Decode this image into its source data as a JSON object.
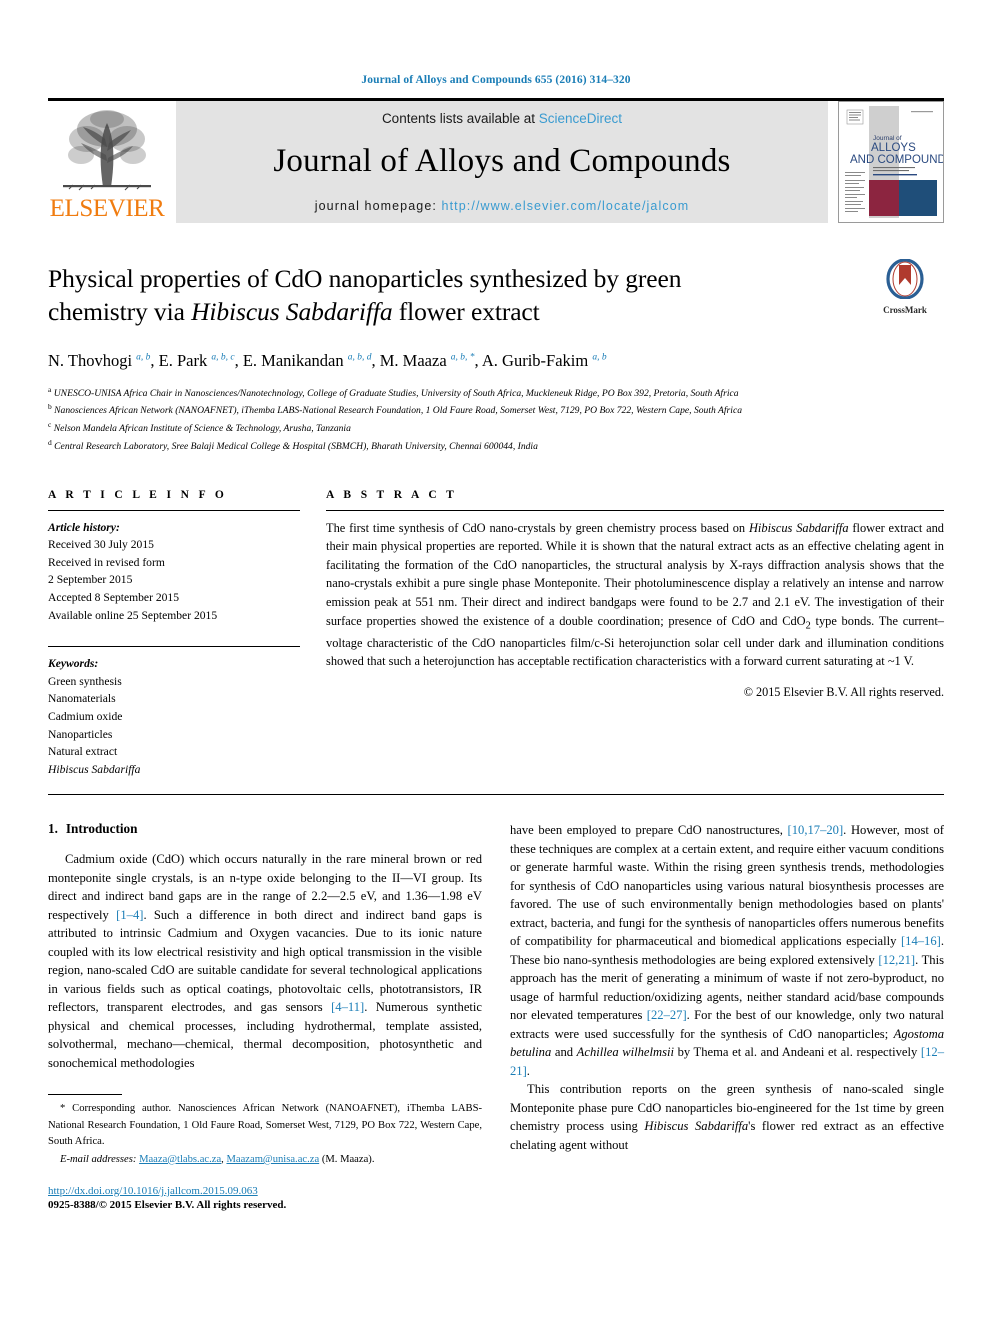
{
  "running_head": "Journal of Alloys and Compounds 655 (2016) 314–320",
  "masthead": {
    "publisher_logo_text": "ELSEVIER",
    "contents_prefix": "Contents lists available at ",
    "contents_link": "ScienceDirect",
    "journal_title": "Journal of Alloys and Compounds",
    "homepage_prefix": "journal homepage: ",
    "homepage_url": "http://www.elsevier.com/locate/jalcom",
    "cover": {
      "line1": "Journal of",
      "line2": "ALLOYS",
      "line3": "AND COMPOUNDS"
    }
  },
  "article": {
    "title_part1": "Physical properties of CdO nanoparticles synthesized by green chemistry via ",
    "title_italic": "Hibiscus Sabdariffa",
    "title_part2": " flower extract",
    "crossmark_label": "CrossMark",
    "authors": [
      {
        "name": "N. Thovhogi",
        "sup": "a, b",
        "sep": ", "
      },
      {
        "name": "E. Park",
        "sup": "a, b, c",
        "sep": ", "
      },
      {
        "name": "E. Manikandan",
        "sup": "a, b, d",
        "sep": ", "
      },
      {
        "name": "M. Maaza",
        "sup": "a, b, *",
        "sep": ", "
      },
      {
        "name": "A. Gurib-Fakim",
        "sup": "a, b",
        "sep": ""
      }
    ],
    "affiliations": [
      {
        "mark": "a",
        "text": "UNESCO-UNISA Africa Chair in Nanosciences/Nanotechnology, College of Graduate Studies, University of South Africa, Muckleneuk Ridge, PO Box 392, Pretoria, South Africa"
      },
      {
        "mark": "b",
        "text": "Nanosciences African Network (NANOAFNET), iThemba LABS-National Research Foundation, 1 Old Faure Road, Somerset West, 7129, PO Box 722, Western Cape, South Africa"
      },
      {
        "mark": "c",
        "text": "Nelson Mandela African Institute of Science & Technology, Arusha, Tanzania"
      },
      {
        "mark": "d",
        "text": "Central Research Laboratory, Sree Balaji Medical College & Hospital (SBMCH), Bharath University, Chennai 600044, India"
      }
    ]
  },
  "article_info": {
    "heading": "A R T I C L E   I N F O",
    "history_label": "Article history:",
    "history": [
      "Received 30 July 2015",
      "Received in revised form",
      "2 September 2015",
      "Accepted 8 September 2015",
      "Available online 25 September 2015"
    ],
    "keywords_label": "Keywords:",
    "keywords": [
      "Green synthesis",
      "Nanomaterials",
      "Cadmium oxide",
      "Nanoparticles",
      "Natural extract",
      "Hibiscus Sabdariffa"
    ],
    "keywords_italic_index": 5
  },
  "abstract": {
    "heading": "A B S T R A C T",
    "p1": "The first time synthesis of CdO nano-crystals by green chemistry process based on ",
    "p1_italic": "Hibiscus Sabdariffa",
    "p2": " flower extract and their main physical properties are reported. While it is shown that the natural extract acts as an effective chelating agent in facilitating the formation of the CdO nanoparticles, the structural analysis by X-rays diffraction analysis shows that the nano-crystals exhibit a pure single phase Monteponite. Their photoluminescence display a relatively an intense and narrow emission peak at 551 nm. Their direct and indirect bandgaps were found to be 2.7 and 2.1 eV. The investigation of their surface properties showed the existence of a double coordination; presence of CdO and CdO",
    "p2_sub": "2",
    "p3": " type bonds. The current–voltage characteristic of the CdO nanoparticles film/c-Si heterojunction solar cell under dark and illumination conditions showed that such a heterojunction has acceptable rectification characteristics with a forward current saturating at ~1 V.",
    "copyright": "© 2015 Elsevier B.V. All rights reserved."
  },
  "intro": {
    "heading_num": "1.",
    "heading_text": "Introduction",
    "left_p1_a": "Cadmium oxide (CdO) which occurs naturally in the rare mineral brown or red monteponite single crystals, is an n-type oxide belonging to the II—VI group. Its direct and indirect band gaps are in the range of 2.2—2.5 eV, and 1.36—1.98 eV respectively ",
    "left_ref1": "[1–4]",
    "left_p1_b": ". Such a difference in both direct and indirect band gaps is attributed to intrinsic Cadmium and Oxygen vacancies. Due to its ionic nature coupled with its low electrical resistivity and high optical transmission in the visible region, nano-scaled CdO are suitable candidate for several technological applications in various fields such as optical coatings, photovoltaic cells, phototransistors, IR reflectors, transparent electrodes, and gas sensors ",
    "left_ref2": "[4–11]",
    "left_p1_c": ". Numerous synthetic physical and chemical processes, including hydrothermal, template assisted, solvothermal, mechano—chemical, thermal decomposition, photosynthetic and sonochemical methodologies",
    "right_p1_a": "have been employed to prepare CdO nanostructures, ",
    "right_ref1": "[10,17–20]",
    "right_p1_b": ". However, most of these techniques are complex at a certain extent, and require either vacuum conditions or generate harmful waste. Within the rising green synthesis trends, methodologies for synthesis of CdO nanoparticles using various natural biosynthesis processes are favored. The use of such environmentally benign methodologies based on plants' extract, bacteria, and fungi for the synthesis of nanoparticles offers numerous benefits of compatibility for pharmaceutical and biomedical applications especially ",
    "right_ref2": "[14–16]",
    "right_p1_c": ". These bio nano-synthesis methodologies are being explored extensively ",
    "right_ref3": "[12,21]",
    "right_p1_d": ". This approach has the merit of generating a minimum of waste if not zero-byproduct, no usage of harmful reduction/oxidizing agents, neither standard acid/base compounds nor elevated temperatures ",
    "right_ref4": "[22–27]",
    "right_p1_e": ". For the best of our knowledge, only two natural extracts were used successfully for the synthesis of CdO nanoparticles; ",
    "right_it1": "Agostoma betulina",
    "right_p1_f": " and ",
    "right_it2": "Achillea wilhelmsii",
    "right_p1_g": " by Thema et al. and Andeani et al. respectively ",
    "right_ref5": "[12–21]",
    "right_p1_h": ".",
    "right_p2_a": "This contribution reports on the green synthesis of nano-scaled single Monteponite phase pure CdO nanoparticles bio-engineered for the 1st time by green chemistry process using ",
    "right_it3": "Hibiscus Sabdariffa",
    "right_p2_b": "'s flower red extract as an effective chelating agent without"
  },
  "footnote": {
    "star": "*",
    "text": " Corresponding author. Nanosciences African Network (NANOAFNET), iThemba LABS-National Research Foundation, 1 Old Faure Road, Somerset West, 7129, PO Box 722, Western Cape, South Africa.",
    "email_label": "E-mail addresses:",
    "email1": "Maaza@tlabs.ac.za",
    "email_sep": ", ",
    "email2": "Maazam@unisa.ac.za",
    "email_suffix": " (M. Maaza).",
    "doi": "http://dx.doi.org/10.1016/j.jallcom.2015.09.063",
    "issn": "0925-8388/© 2015 Elsevier B.V. All rights reserved."
  },
  "colors": {
    "link_blue": "#1a7db6",
    "sciencedirect_blue": "#3a9bd0",
    "elsevier_orange": "#f07c10",
    "masthead_gray": "#e3e3e3",
    "cover_maroon": "#8c2540",
    "cover_navy": "#1f4e79"
  }
}
